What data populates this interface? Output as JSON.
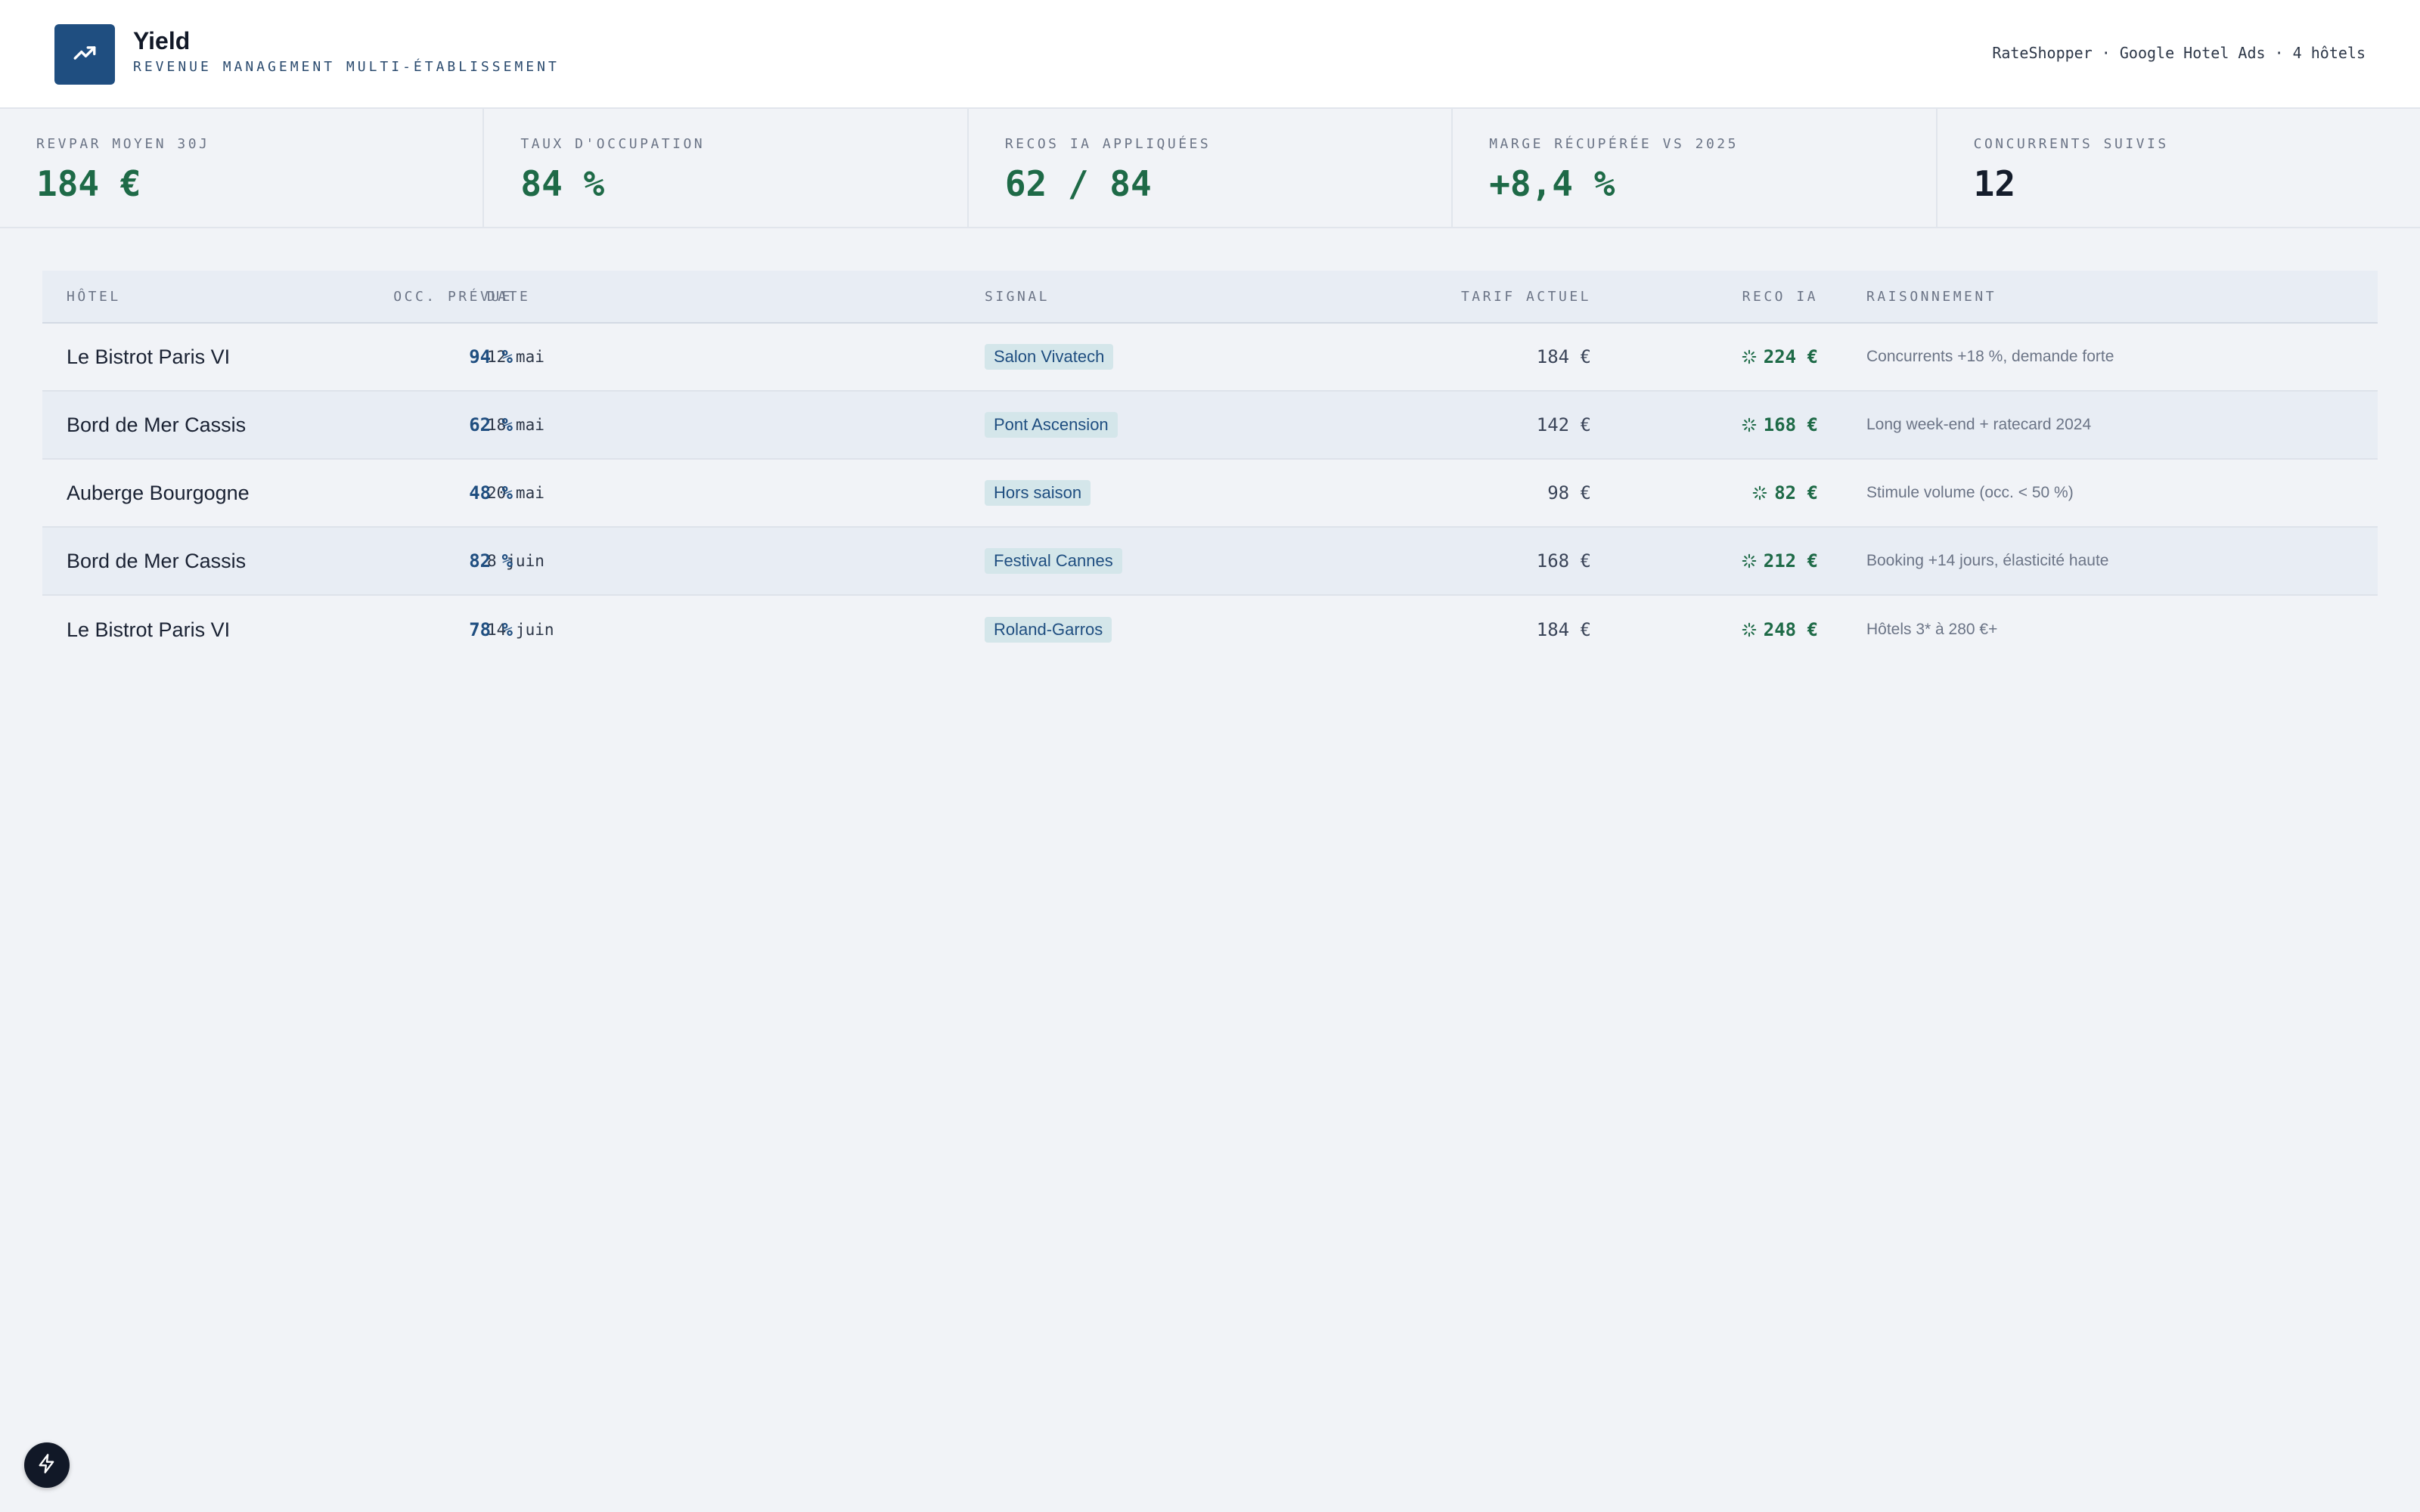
{
  "app": {
    "title": "Yield",
    "subtitle": "REVENUE MANAGEMENT MULTI-ÉTABLISSEMENT",
    "logo_icon": "trending-up-icon",
    "meta": "RateShopper · Google Hotel Ads · 4 hôtels"
  },
  "kpis": [
    {
      "label": "REVPAR MOYEN 30J",
      "value": "184 €"
    },
    {
      "label": "TAUX D'OCCUPATION",
      "value": "84 %"
    },
    {
      "label": "RECOS IA APPLIQUÉES",
      "value": "62 / 84"
    },
    {
      "label": "MARGE RÉCUPÉRÉE VS 2025",
      "value": "+8,4 %"
    },
    {
      "label": "CONCURRENTS SUIVIS",
      "value": "12"
    }
  ],
  "colors": {
    "accent_green": "#1e6a47",
    "accent_blue": "#1f4e80",
    "badge_bg": "#d4e6ea"
  },
  "table": {
    "headers": {
      "hotel": "HÔTEL",
      "date": "DATE",
      "occ": "OCC. PRÉVUE",
      "signal": "SIGNAL",
      "tarif": "TARIF ACTUEL",
      "reco": "RECO IA",
      "reason": "RAISONNEMENT"
    },
    "rows": [
      {
        "hotel": "Le Bistrot Paris VI",
        "date": "12 mai",
        "occ": "94 %",
        "signal": "Salon Vivatech",
        "tarif": "184 €",
        "reco": "224 €",
        "reason": "Concurrents +18 %, demande forte"
      },
      {
        "hotel": "Bord de Mer Cassis",
        "date": "18 mai",
        "occ": "62 %",
        "signal": "Pont Ascension",
        "tarif": "142 €",
        "reco": "168 €",
        "reason": "Long week-end + ratecard 2024"
      },
      {
        "hotel": "Auberge Bourgogne",
        "date": "20 mai",
        "occ": "48 %",
        "signal": "Hors saison",
        "tarif": "98 €",
        "reco": "82 €",
        "reason": "Stimule volume (occ. < 50 %)"
      },
      {
        "hotel": "Bord de Mer Cassis",
        "date": "8 juin",
        "occ": "82 %",
        "signal": "Festival Cannes",
        "tarif": "168 €",
        "reco": "212 €",
        "reason": "Booking +14 jours, élasticité haute"
      },
      {
        "hotel": "Le Bistrot Paris VI",
        "date": "14 juin",
        "occ": "78 %",
        "signal": "Roland-Garros",
        "tarif": "184 €",
        "reco": "248 €",
        "reason": "Hôtels 3* à 280 €+"
      }
    ]
  },
  "fab": {
    "icon": "lightning-icon"
  }
}
